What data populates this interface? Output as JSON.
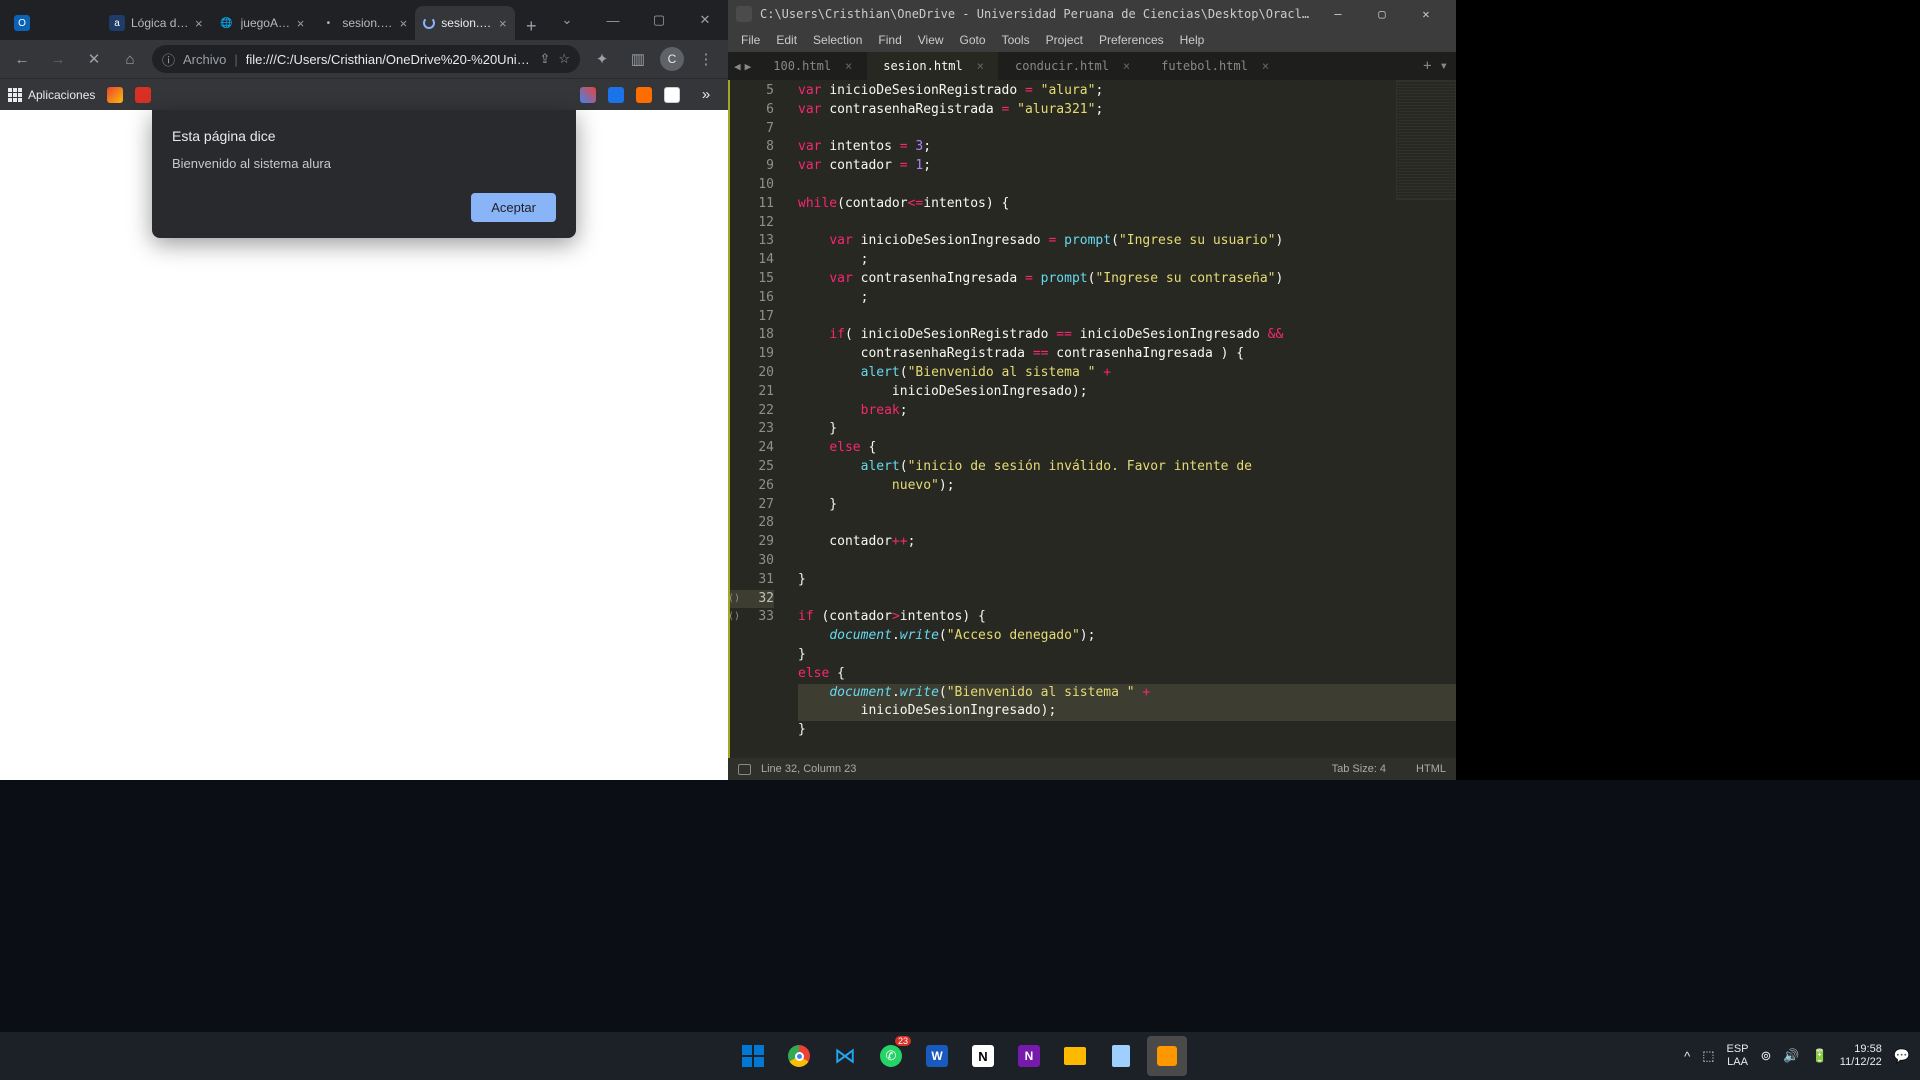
{
  "chrome": {
    "tabs": [
      {
        "favicon_letter": "O",
        "favicon_bg": "#0a63b5",
        "title": ""
      },
      {
        "favicon_letter": "a",
        "favicon_bg": "#1f3b68",
        "title": "Lógica de …"
      },
      {
        "favicon_letter": "🌐",
        "favicon_bg": "#555",
        "title": "juegoAdi…"
      },
      {
        "favicon_letter": "",
        "favicon_bg": "transparent",
        "title": "sesion.ht…"
      },
      {
        "favicon_letter": "",
        "favicon_bg": "transparent",
        "title": "sesion.ht…"
      }
    ],
    "toolbar": {
      "url_prefix": "Archivo",
      "url": "file:///C:/Users/Cristhian/OneDrive%20-%20Unive…",
      "profile_letter": "C"
    },
    "bookmarks": {
      "apps_label": "Aplicaciones"
    },
    "dialog": {
      "title": "Esta página dice",
      "message": "Bienvenido al sistema alura",
      "accept_label": "Aceptar"
    }
  },
  "sublime": {
    "title_path": "C:\\Users\\Cristhian\\OneDrive - Universidad Peruana de Ciencias\\Desktop\\Oracle\\Lógica de programación\\sesio…",
    "menu": [
      "File",
      "Edit",
      "Selection",
      "Find",
      "View",
      "Goto",
      "Tools",
      "Project",
      "Preferences",
      "Help"
    ],
    "tabs": [
      {
        "name": "100.html",
        "active": false
      },
      {
        "name": "sesion.html",
        "active": true
      },
      {
        "name": "conducir.html",
        "active": false
      },
      {
        "name": "futebol.html",
        "active": false
      }
    ],
    "lines": [
      {
        "n": 5,
        "t": [
          [
            "kw",
            "var "
          ],
          [
            "id",
            "inicioDeSesionRegistrado "
          ],
          [
            "op",
            "="
          ],
          [
            "pun",
            " "
          ],
          [
            "str",
            "\"alura\""
          ],
          [
            "pun",
            ";"
          ]
        ]
      },
      {
        "n": 6,
        "t": [
          [
            "kw",
            "var "
          ],
          [
            "id",
            "contrasenhaRegistrada "
          ],
          [
            "op",
            "="
          ],
          [
            "pun",
            " "
          ],
          [
            "str",
            "\"alura321\""
          ],
          [
            "pun",
            ";"
          ]
        ]
      },
      {
        "n": 7,
        "t": []
      },
      {
        "n": 8,
        "t": [
          [
            "kw",
            "var "
          ],
          [
            "id",
            "intentos "
          ],
          [
            "op",
            "="
          ],
          [
            "pun",
            " "
          ],
          [
            "num",
            "3"
          ],
          [
            "pun",
            ";"
          ]
        ]
      },
      {
        "n": 9,
        "t": [
          [
            "kw",
            "var "
          ],
          [
            "id",
            "contador "
          ],
          [
            "op",
            "="
          ],
          [
            "pun",
            " "
          ],
          [
            "num",
            "1"
          ],
          [
            "pun",
            ";"
          ]
        ]
      },
      {
        "n": 10,
        "t": []
      },
      {
        "n": 11,
        "t": [
          [
            "kw",
            "while"
          ],
          [
            "pun",
            "(contador"
          ],
          [
            "op",
            "<="
          ],
          [
            "pun",
            "intentos) {"
          ]
        ]
      },
      {
        "n": 12,
        "t": []
      },
      {
        "n": 13,
        "t": [
          [
            "pun",
            "    "
          ],
          [
            "kw",
            "var "
          ],
          [
            "id",
            "inicioDeSesionIngresado "
          ],
          [
            "op",
            "="
          ],
          [
            "pun",
            " "
          ],
          [
            "fn",
            "prompt"
          ],
          [
            "pun",
            "("
          ],
          [
            "str",
            "\"Ingrese su usuario\""
          ],
          [
            "pun",
            ")"
          ]
        ]
      },
      {
        "n": "",
        "t": [
          [
            "pun",
            "        ;"
          ]
        ]
      },
      {
        "n": 14,
        "t": [
          [
            "pun",
            "    "
          ],
          [
            "kw",
            "var "
          ],
          [
            "id",
            "contrasenhaIngresada "
          ],
          [
            "op",
            "="
          ],
          [
            "pun",
            " "
          ],
          [
            "fn",
            "prompt"
          ],
          [
            "pun",
            "("
          ],
          [
            "str",
            "\"Ingrese su contraseña\""
          ],
          [
            "pun",
            ")"
          ]
        ]
      },
      {
        "n": "",
        "t": [
          [
            "pun",
            "        ;"
          ]
        ]
      },
      {
        "n": 15,
        "t": []
      },
      {
        "n": 16,
        "t": [
          [
            "pun",
            "    "
          ],
          [
            "kw",
            "if"
          ],
          [
            "pun",
            "( inicioDeSesionRegistrado "
          ],
          [
            "op",
            "=="
          ],
          [
            "pun",
            " inicioDeSesionIngresado "
          ],
          [
            "op",
            "&&"
          ]
        ]
      },
      {
        "n": "",
        "t": [
          [
            "pun",
            "        contrasenhaRegistrada "
          ],
          [
            "op",
            "=="
          ],
          [
            "pun",
            " contrasenhaIngresada ) {"
          ]
        ]
      },
      {
        "n": 17,
        "t": [
          [
            "pun",
            "        "
          ],
          [
            "fn",
            "alert"
          ],
          [
            "pun",
            "("
          ],
          [
            "str",
            "\"Bienvenido al sistema \""
          ],
          [
            "pun",
            " "
          ],
          [
            "op",
            "+"
          ],
          [
            "pun",
            " "
          ]
        ]
      },
      {
        "n": "",
        "t": [
          [
            "pun",
            "            inicioDeSesionIngresado);"
          ]
        ]
      },
      {
        "n": 18,
        "t": [
          [
            "pun",
            "        "
          ],
          [
            "kw",
            "break"
          ],
          [
            "pun",
            ";"
          ]
        ]
      },
      {
        "n": 19,
        "t": [
          [
            "pun",
            "    }"
          ]
        ]
      },
      {
        "n": 20,
        "t": [
          [
            "pun",
            "    "
          ],
          [
            "kw",
            "else"
          ],
          [
            "pun",
            " {"
          ]
        ]
      },
      {
        "n": 21,
        "t": [
          [
            "pun",
            "        "
          ],
          [
            "fn",
            "alert"
          ],
          [
            "pun",
            "("
          ],
          [
            "str",
            "\"inicio de sesión inválido. Favor intente de "
          ]
        ]
      },
      {
        "n": "",
        "t": [
          [
            "pun",
            "            "
          ],
          [
            "str",
            "nuevo\""
          ],
          [
            "pun",
            ");"
          ]
        ]
      },
      {
        "n": 22,
        "t": [
          [
            "pun",
            "    }"
          ]
        ]
      },
      {
        "n": 23,
        "t": []
      },
      {
        "n": 24,
        "t": [
          [
            "pun",
            "    contador"
          ],
          [
            "op",
            "++"
          ],
          [
            "pun",
            ";"
          ]
        ]
      },
      {
        "n": 25,
        "t": []
      },
      {
        "n": 26,
        "t": [
          [
            "pun",
            "}"
          ]
        ]
      },
      {
        "n": 27,
        "t": []
      },
      {
        "n": 28,
        "t": [
          [
            "kw",
            "if"
          ],
          [
            "pun",
            " (contador"
          ],
          [
            "op",
            ">"
          ],
          [
            "pun",
            "intentos) {"
          ]
        ]
      },
      {
        "n": 29,
        "t": [
          [
            "pun",
            "    "
          ],
          [
            "fni",
            "document"
          ],
          [
            "pun",
            "."
          ],
          [
            "fni",
            "write"
          ],
          [
            "pun",
            "("
          ],
          [
            "str",
            "\"Acceso denegado\""
          ],
          [
            "pun",
            ");"
          ]
        ]
      },
      {
        "n": 30,
        "t": [
          [
            "pun",
            "}"
          ]
        ]
      },
      {
        "n": 31,
        "t": [
          [
            "kw",
            "else"
          ],
          [
            "pun",
            " {"
          ]
        ]
      },
      {
        "n": 32,
        "hi": true,
        "t": [
          [
            "pun",
            "    "
          ],
          [
            "fni",
            "document"
          ],
          [
            "pun",
            "."
          ],
          [
            "fni",
            "write"
          ],
          [
            "pun",
            "("
          ],
          [
            "str",
            "\"Bienvenido al sistema \""
          ],
          [
            "pun",
            " "
          ],
          [
            "op",
            "+"
          ],
          [
            "pun",
            " "
          ]
        ]
      },
      {
        "n": "",
        "hi": true,
        "t": [
          [
            "pun",
            "        inicioDeSesionIngresado);"
          ]
        ]
      },
      {
        "n": 33,
        "t": [
          [
            "pun",
            "}"
          ]
        ]
      }
    ],
    "status": {
      "position": "Line 32, Column 23",
      "tab_size": "Tab Size: 4",
      "syntax": "HTML"
    }
  },
  "taskbar": {
    "lang_top": "ESP",
    "lang_bottom": "LAA",
    "time": "19:58",
    "date": "11/12/22",
    "whatsapp_badge": "23"
  }
}
